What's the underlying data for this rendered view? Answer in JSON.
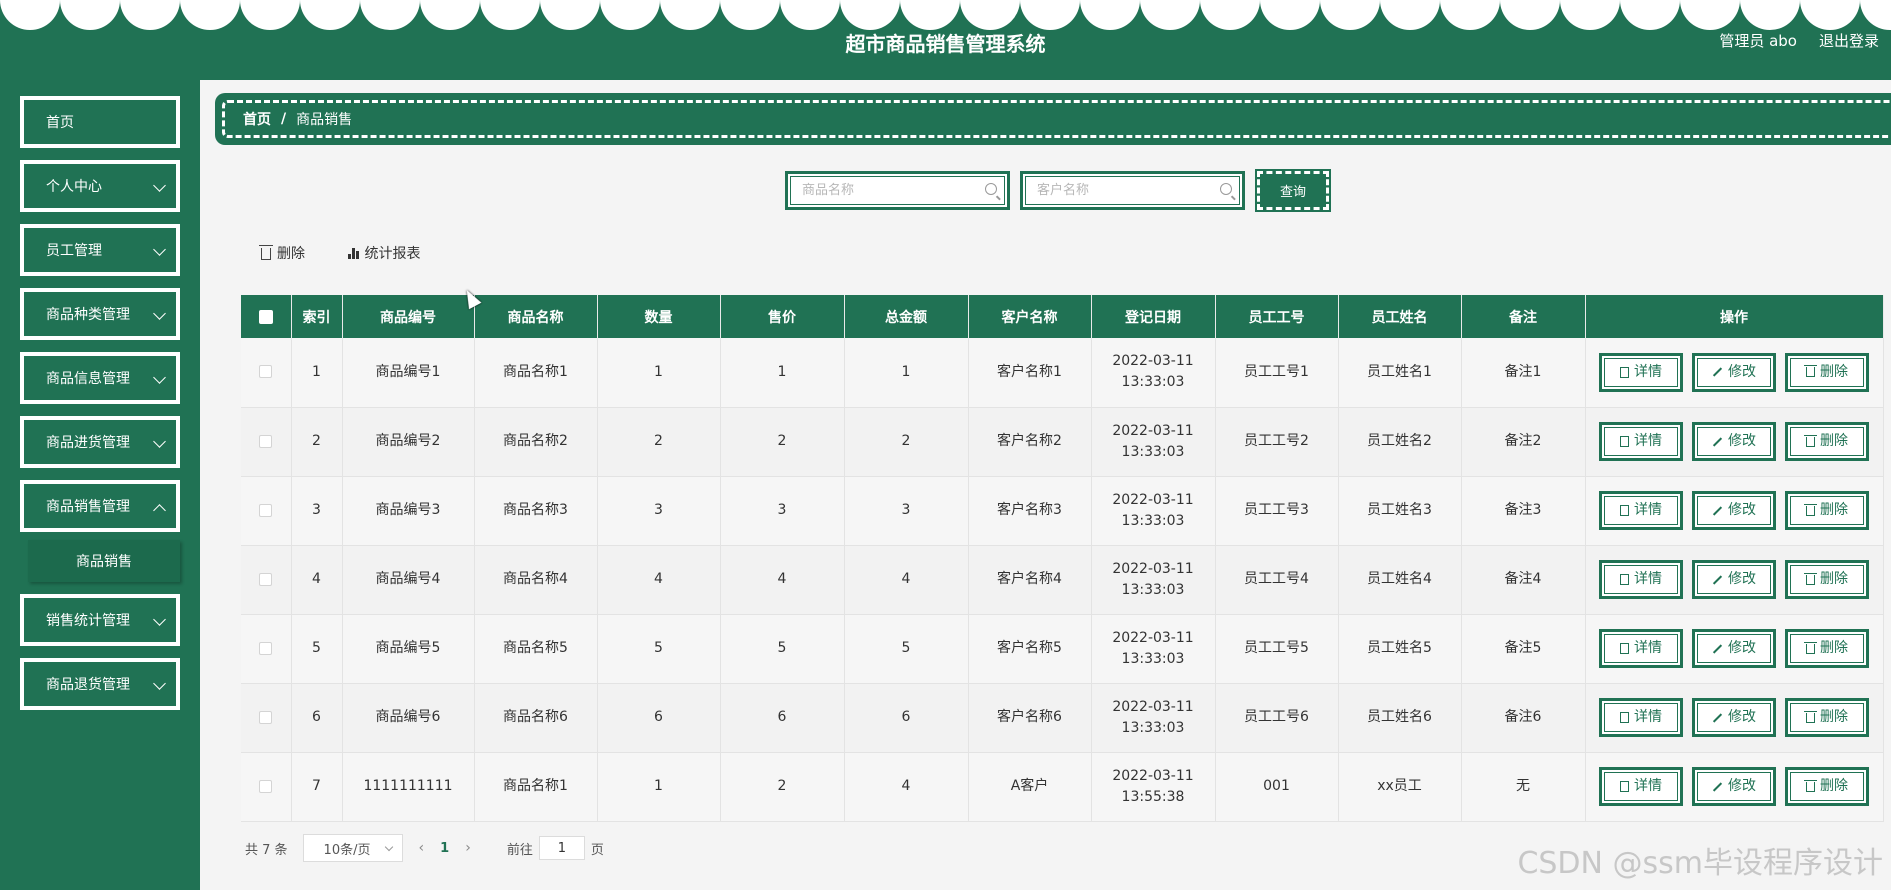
{
  "header": {
    "title": "超市商品销售管理系统",
    "user": "管理员 abo",
    "logout": "退出登录"
  },
  "sidebar": {
    "items": [
      {
        "label": "首页",
        "has_children": false
      },
      {
        "label": "个人中心",
        "has_children": true
      },
      {
        "label": "员工管理",
        "has_children": true
      },
      {
        "label": "商品种类管理",
        "has_children": true
      },
      {
        "label": "商品信息管理",
        "has_children": true
      },
      {
        "label": "商品进货管理",
        "has_children": true
      },
      {
        "label": "商品销售管理",
        "has_children": true
      },
      {
        "label": "销售统计管理",
        "has_children": true
      },
      {
        "label": "商品退货管理",
        "has_children": true
      }
    ],
    "submenu_active": "商品销售"
  },
  "breadcrumb": {
    "home": "首页",
    "separator": "/",
    "current": "商品销售"
  },
  "search": {
    "product_placeholder": "商品名称",
    "customer_placeholder": "客户名称",
    "query_label": "查询"
  },
  "toolbar": {
    "delete_label": "删除",
    "report_label": "统计报表"
  },
  "table": {
    "columns": [
      "索引",
      "商品编号",
      "商品名称",
      "数量",
      "售价",
      "总金额",
      "客户名称",
      "登记日期",
      "员工工号",
      "员工姓名",
      "备注",
      "操作"
    ],
    "rows": [
      [
        "1",
        "商品编号1",
        "商品名称1",
        "1",
        "1",
        "1",
        "客户名称1",
        "2022-03-11 13:33:03",
        "员工工号1",
        "员工姓名1",
        "备注1"
      ],
      [
        "2",
        "商品编号2",
        "商品名称2",
        "2",
        "2",
        "2",
        "客户名称2",
        "2022-03-11 13:33:03",
        "员工工号2",
        "员工姓名2",
        "备注2"
      ],
      [
        "3",
        "商品编号3",
        "商品名称3",
        "3",
        "3",
        "3",
        "客户名称3",
        "2022-03-11 13:33:03",
        "员工工号3",
        "员工姓名3",
        "备注3"
      ],
      [
        "4",
        "商品编号4",
        "商品名称4",
        "4",
        "4",
        "4",
        "客户名称4",
        "2022-03-11 13:33:03",
        "员工工号4",
        "员工姓名4",
        "备注4"
      ],
      [
        "5",
        "商品编号5",
        "商品名称5",
        "5",
        "5",
        "5",
        "客户名称5",
        "2022-03-11 13:33:03",
        "员工工号5",
        "员工姓名5",
        "备注5"
      ],
      [
        "6",
        "商品编号6",
        "商品名称6",
        "6",
        "6",
        "6",
        "客户名称6",
        "2022-03-11 13:33:03",
        "员工工号6",
        "员工姓名6",
        "备注6"
      ],
      [
        "7",
        "1111111111",
        "商品名称1",
        "1",
        "2",
        "4",
        "A客户",
        "2022-03-11 13:55:38",
        "001",
        "xx员工",
        "无"
      ]
    ],
    "actions": [
      "详情",
      "修改",
      "删除"
    ]
  },
  "pagination": {
    "total_text": "共 7 条",
    "page_size": "10条/页",
    "prev": "‹",
    "current_page": "1",
    "next": "›",
    "goto_label": "前往",
    "goto_value": "1",
    "page_suffix": "页"
  },
  "watermark": "CSDN @ssm毕设程序设计",
  "colors": {
    "primary": "#207254",
    "background": "#f4f4f4",
    "white": "#ffffff"
  }
}
